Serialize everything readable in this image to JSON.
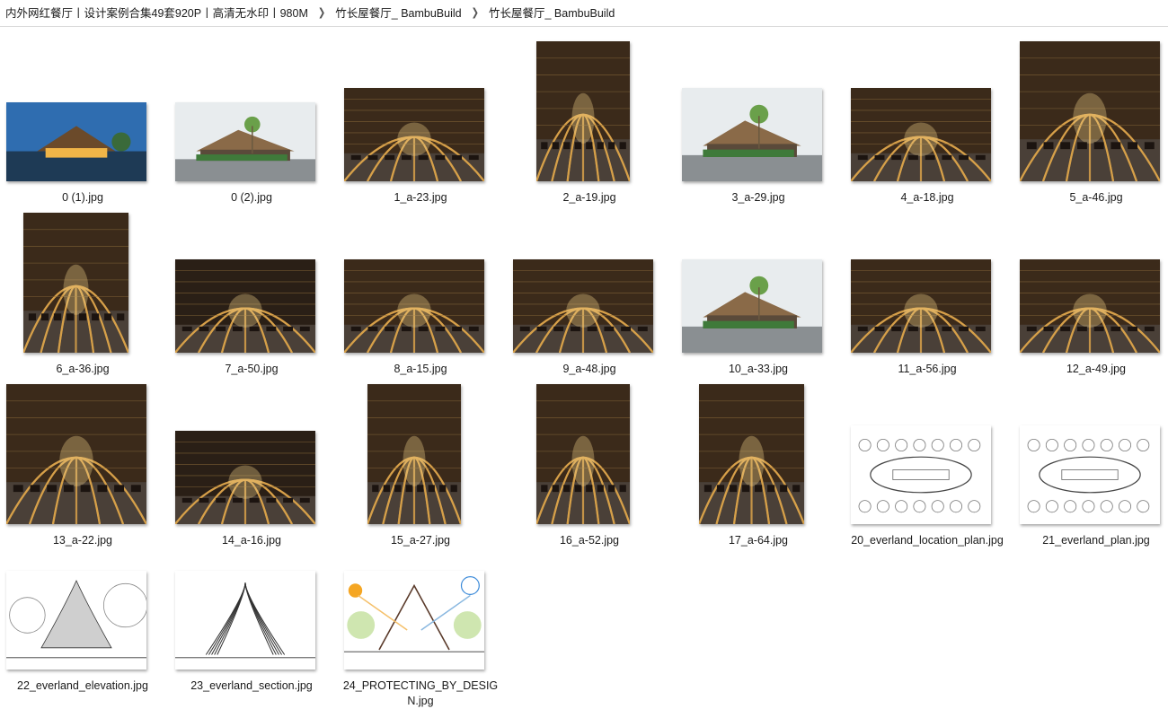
{
  "breadcrumb": {
    "items": [
      "内外网红餐厅丨设计案例合集49套920P丨高清无水印丨980M",
      "竹长屋餐厅_ BambuBuild",
      "竹长屋餐厅_ BambuBuild"
    ]
  },
  "files": [
    {
      "name": "0 (1).jpg",
      "kind": "exterior-dusk"
    },
    {
      "name": "0 (2).jpg",
      "kind": "exterior-day"
    },
    {
      "name": "1_a-23.jpg",
      "kind": "interior"
    },
    {
      "name": "2_a-19.jpg",
      "kind": "interior"
    },
    {
      "name": "3_a-29.jpg",
      "kind": "exterior-day"
    },
    {
      "name": "4_a-18.jpg",
      "kind": "interior"
    },
    {
      "name": "5_a-46.jpg",
      "kind": "interior"
    },
    {
      "name": "6_a-36.jpg",
      "kind": "interior"
    },
    {
      "name": "7_a-50.jpg",
      "kind": "interior-dark"
    },
    {
      "name": "8_a-15.jpg",
      "kind": "interior"
    },
    {
      "name": "9_a-48.jpg",
      "kind": "interior"
    },
    {
      "name": "10_a-33.jpg",
      "kind": "exterior-day"
    },
    {
      "name": "11_a-56.jpg",
      "kind": "interior"
    },
    {
      "name": "12_a-49.jpg",
      "kind": "interior"
    },
    {
      "name": "13_a-22.jpg",
      "kind": "interior"
    },
    {
      "name": "14_a-16.jpg",
      "kind": "interior-dark"
    },
    {
      "name": "15_a-27.jpg",
      "kind": "interior"
    },
    {
      "name": "16_a-52.jpg",
      "kind": "interior"
    },
    {
      "name": "17_a-64.jpg",
      "kind": "interior"
    },
    {
      "name": "20_everland_location_plan.jpg",
      "kind": "drawing-plan"
    },
    {
      "name": "21_everland_plan.jpg",
      "kind": "drawing-plan"
    },
    {
      "name": "22_everland_elevation.jpg",
      "kind": "drawing-elevation"
    },
    {
      "name": "23_everland_section.jpg",
      "kind": "drawing-section"
    },
    {
      "name": "24_PROTECTING_BY_DESIGN.jpg",
      "kind": "drawing-diagram"
    }
  ],
  "icons": {
    "separator": "chevron-right-icon"
  },
  "colors": {
    "selection": "#e5f3ff",
    "divider": "#dadada"
  }
}
